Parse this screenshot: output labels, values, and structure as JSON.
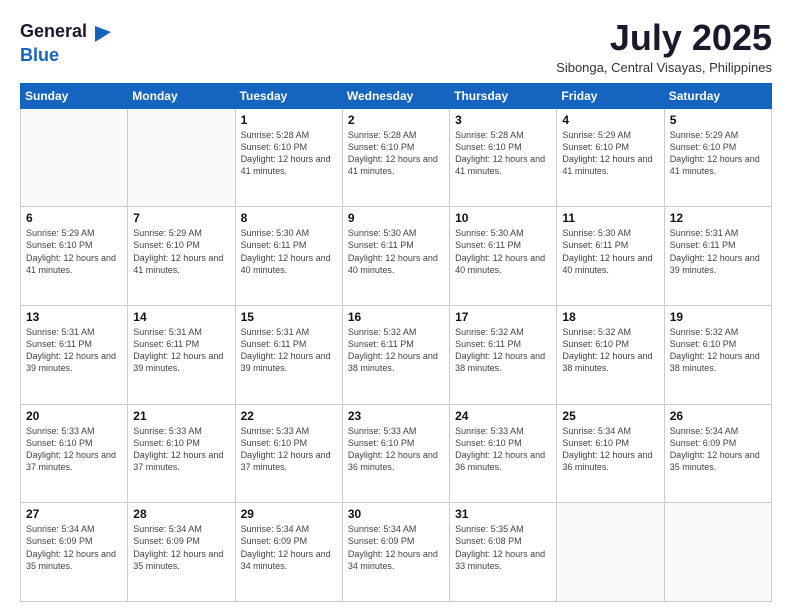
{
  "logo": {
    "general": "General",
    "blue": "Blue"
  },
  "title": "July 2025",
  "location": "Sibonga, Central Visayas, Philippines",
  "days_of_week": [
    "Sunday",
    "Monday",
    "Tuesday",
    "Wednesday",
    "Thursday",
    "Friday",
    "Saturday"
  ],
  "weeks": [
    [
      {
        "day": "",
        "info": ""
      },
      {
        "day": "",
        "info": ""
      },
      {
        "day": "1",
        "info": "Sunrise: 5:28 AM\nSunset: 6:10 PM\nDaylight: 12 hours and 41 minutes."
      },
      {
        "day": "2",
        "info": "Sunrise: 5:28 AM\nSunset: 6:10 PM\nDaylight: 12 hours and 41 minutes."
      },
      {
        "day": "3",
        "info": "Sunrise: 5:28 AM\nSunset: 6:10 PM\nDaylight: 12 hours and 41 minutes."
      },
      {
        "day": "4",
        "info": "Sunrise: 5:29 AM\nSunset: 6:10 PM\nDaylight: 12 hours and 41 minutes."
      },
      {
        "day": "5",
        "info": "Sunrise: 5:29 AM\nSunset: 6:10 PM\nDaylight: 12 hours and 41 minutes."
      }
    ],
    [
      {
        "day": "6",
        "info": "Sunrise: 5:29 AM\nSunset: 6:10 PM\nDaylight: 12 hours and 41 minutes."
      },
      {
        "day": "7",
        "info": "Sunrise: 5:29 AM\nSunset: 6:10 PM\nDaylight: 12 hours and 41 minutes."
      },
      {
        "day": "8",
        "info": "Sunrise: 5:30 AM\nSunset: 6:11 PM\nDaylight: 12 hours and 40 minutes."
      },
      {
        "day": "9",
        "info": "Sunrise: 5:30 AM\nSunset: 6:11 PM\nDaylight: 12 hours and 40 minutes."
      },
      {
        "day": "10",
        "info": "Sunrise: 5:30 AM\nSunset: 6:11 PM\nDaylight: 12 hours and 40 minutes."
      },
      {
        "day": "11",
        "info": "Sunrise: 5:30 AM\nSunset: 6:11 PM\nDaylight: 12 hours and 40 minutes."
      },
      {
        "day": "12",
        "info": "Sunrise: 5:31 AM\nSunset: 6:11 PM\nDaylight: 12 hours and 39 minutes."
      }
    ],
    [
      {
        "day": "13",
        "info": "Sunrise: 5:31 AM\nSunset: 6:11 PM\nDaylight: 12 hours and 39 minutes."
      },
      {
        "day": "14",
        "info": "Sunrise: 5:31 AM\nSunset: 6:11 PM\nDaylight: 12 hours and 39 minutes."
      },
      {
        "day": "15",
        "info": "Sunrise: 5:31 AM\nSunset: 6:11 PM\nDaylight: 12 hours and 39 minutes."
      },
      {
        "day": "16",
        "info": "Sunrise: 5:32 AM\nSunset: 6:11 PM\nDaylight: 12 hours and 38 minutes."
      },
      {
        "day": "17",
        "info": "Sunrise: 5:32 AM\nSunset: 6:11 PM\nDaylight: 12 hours and 38 minutes."
      },
      {
        "day": "18",
        "info": "Sunrise: 5:32 AM\nSunset: 6:10 PM\nDaylight: 12 hours and 38 minutes."
      },
      {
        "day": "19",
        "info": "Sunrise: 5:32 AM\nSunset: 6:10 PM\nDaylight: 12 hours and 38 minutes."
      }
    ],
    [
      {
        "day": "20",
        "info": "Sunrise: 5:33 AM\nSunset: 6:10 PM\nDaylight: 12 hours and 37 minutes."
      },
      {
        "day": "21",
        "info": "Sunrise: 5:33 AM\nSunset: 6:10 PM\nDaylight: 12 hours and 37 minutes."
      },
      {
        "day": "22",
        "info": "Sunrise: 5:33 AM\nSunset: 6:10 PM\nDaylight: 12 hours and 37 minutes."
      },
      {
        "day": "23",
        "info": "Sunrise: 5:33 AM\nSunset: 6:10 PM\nDaylight: 12 hours and 36 minutes."
      },
      {
        "day": "24",
        "info": "Sunrise: 5:33 AM\nSunset: 6:10 PM\nDaylight: 12 hours and 36 minutes."
      },
      {
        "day": "25",
        "info": "Sunrise: 5:34 AM\nSunset: 6:10 PM\nDaylight: 12 hours and 36 minutes."
      },
      {
        "day": "26",
        "info": "Sunrise: 5:34 AM\nSunset: 6:09 PM\nDaylight: 12 hours and 35 minutes."
      }
    ],
    [
      {
        "day": "27",
        "info": "Sunrise: 5:34 AM\nSunset: 6:09 PM\nDaylight: 12 hours and 35 minutes."
      },
      {
        "day": "28",
        "info": "Sunrise: 5:34 AM\nSunset: 6:09 PM\nDaylight: 12 hours and 35 minutes."
      },
      {
        "day": "29",
        "info": "Sunrise: 5:34 AM\nSunset: 6:09 PM\nDaylight: 12 hours and 34 minutes."
      },
      {
        "day": "30",
        "info": "Sunrise: 5:34 AM\nSunset: 6:09 PM\nDaylight: 12 hours and 34 minutes."
      },
      {
        "day": "31",
        "info": "Sunrise: 5:35 AM\nSunset: 6:08 PM\nDaylight: 12 hours and 33 minutes."
      },
      {
        "day": "",
        "info": ""
      },
      {
        "day": "",
        "info": ""
      }
    ]
  ]
}
